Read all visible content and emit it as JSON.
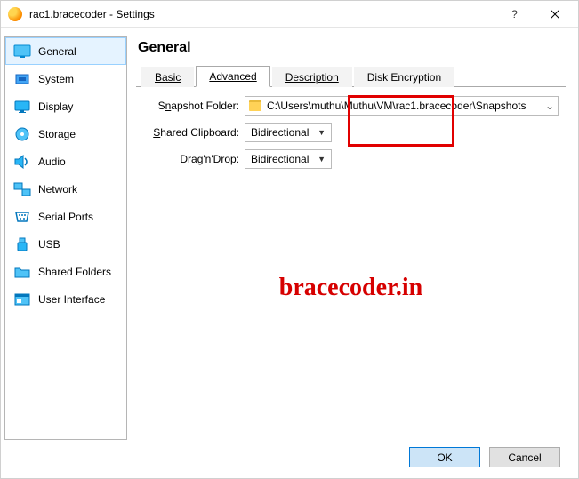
{
  "window": {
    "title": "rac1.bracecoder - Settings",
    "helpGlyph": "?",
    "minGlyph": "—",
    "closeGlyph": "×"
  },
  "sidebar": {
    "items": [
      {
        "label": "General"
      },
      {
        "label": "System"
      },
      {
        "label": "Display"
      },
      {
        "label": "Storage"
      },
      {
        "label": "Audio"
      },
      {
        "label": "Network"
      },
      {
        "label": "Serial Ports"
      },
      {
        "label": "USB"
      },
      {
        "label": "Shared Folders"
      },
      {
        "label": "User Interface"
      }
    ]
  },
  "page": {
    "title": "General",
    "tabs": {
      "basic": "Basic",
      "advanced": "Advanced",
      "description": "Description",
      "disk": "Disk Encryption"
    }
  },
  "form": {
    "snapshotLabel_pre": "S",
    "snapshotLabel_u": "n",
    "snapshotLabel_post": "apshot Folder:",
    "snapshotPath": "C:\\Users\\muthu\\Muthu\\VM\\rac1.bracecoder\\Snapshots",
    "clipboardLabel_u": "S",
    "clipboardLabel_post": "hared Clipboard:",
    "clipboardValue": "Bidirectional",
    "dragLabel_pre": "D",
    "dragLabel_u": "r",
    "dragLabel_post": "ag'n'Drop:",
    "dragValue": "Bidirectional"
  },
  "watermark": "bracecoder.in",
  "buttons": {
    "ok": "OK",
    "cancel": "Cancel"
  }
}
